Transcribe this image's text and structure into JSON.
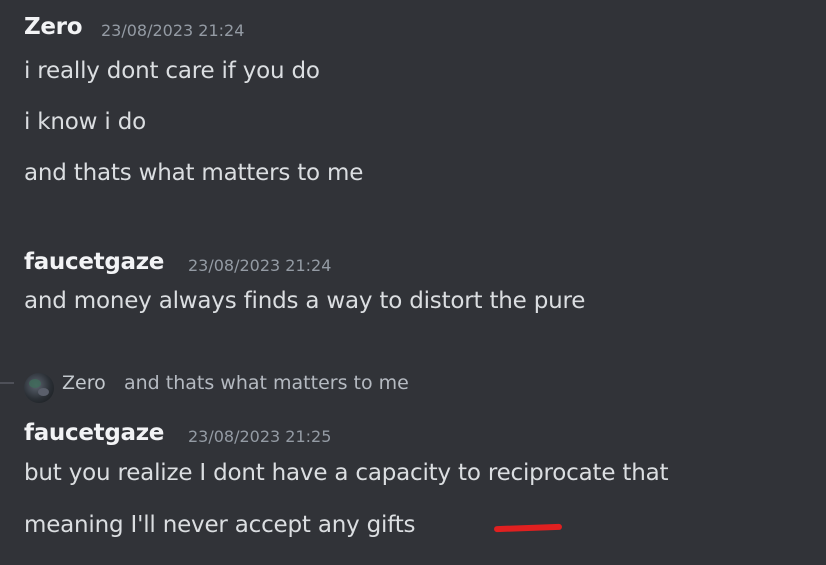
{
  "messages": [
    {
      "author": "Zero",
      "timestamp": "23/08/2023 21:24",
      "lines": [
        "i really dont care if you do",
        "i know i do",
        "and thats what matters to me"
      ]
    },
    {
      "author": "faucetgaze",
      "timestamp": "23/08/2023 21:24",
      "lines": [
        "and money always finds a way to distort the pure"
      ]
    },
    {
      "reply_to": {
        "author": "Zero",
        "text": "and thats what matters to me"
      },
      "author": "faucetgaze",
      "timestamp": "23/08/2023 21:25",
      "lines": [
        "but you realize I dont have a capacity to reciprocate that",
        "meaning I'll never accept any gifts"
      ]
    }
  ],
  "colors": {
    "background": "#313338",
    "username": "#f2f3f5",
    "timestamp": "#949ba4",
    "message_text": "#dbdee1",
    "annotation_mark": "#e02020"
  }
}
